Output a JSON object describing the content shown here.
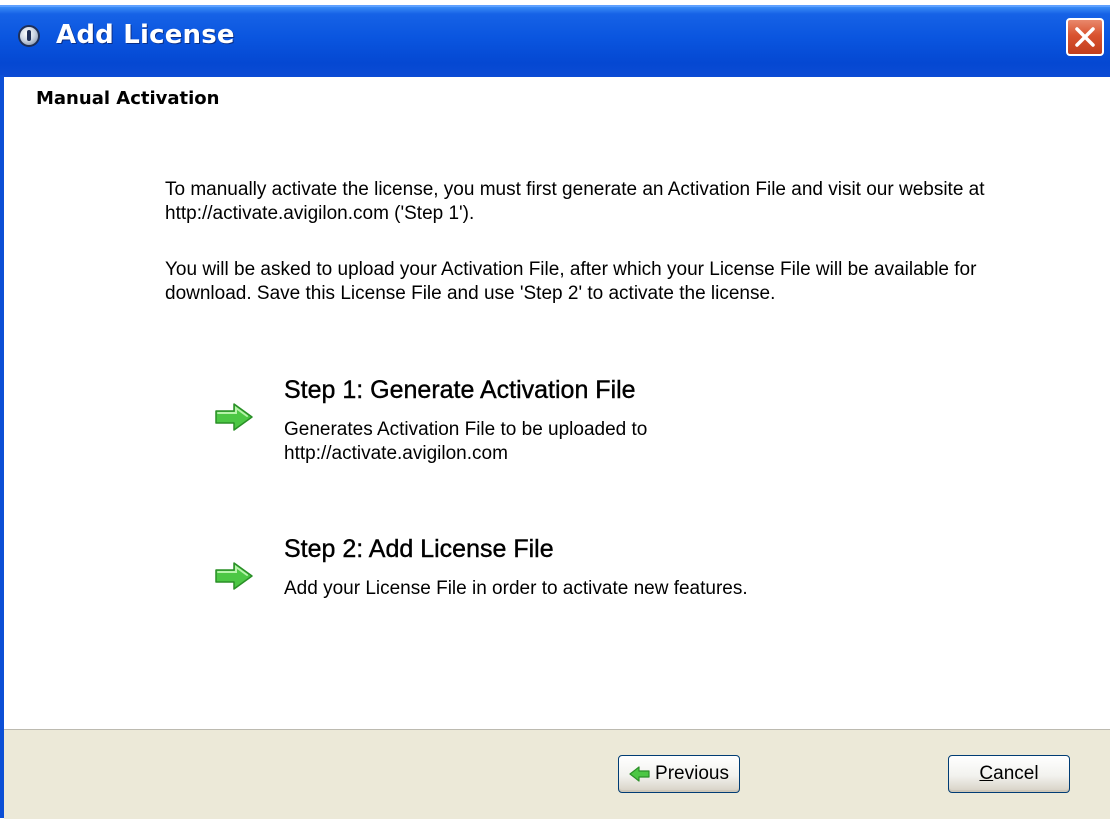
{
  "window": {
    "title": "Add License"
  },
  "header": {
    "title": "Manual Activation"
  },
  "instructions": {
    "paragraph1": "To manually activate the license, you must first generate an Activation File and visit our website at http://activate.avigilon.com ('Step 1').",
    "paragraph2": "You will be asked to upload your Activation File, after which your License File will be available for download. Save this License File and use 'Step 2' to activate the license."
  },
  "steps": [
    {
      "title": "Step 1: Generate Activation File",
      "description": "Generates Activation File to be uploaded to http://activate.avigilon.com",
      "icon": "green-arrow-icon"
    },
    {
      "title": "Step 2: Add License File",
      "description": "Add your License File in order to activate new features.",
      "icon": "green-arrow-icon"
    }
  ],
  "footer": {
    "previous_label": "Previous",
    "cancel_first_letter": "C",
    "cancel_rest": "ancel"
  },
  "colors": {
    "titlebar": "#0548d2",
    "footer": "#ece9d8",
    "close_button": "#d9532f",
    "arrow_green": "#3fbd3a"
  }
}
